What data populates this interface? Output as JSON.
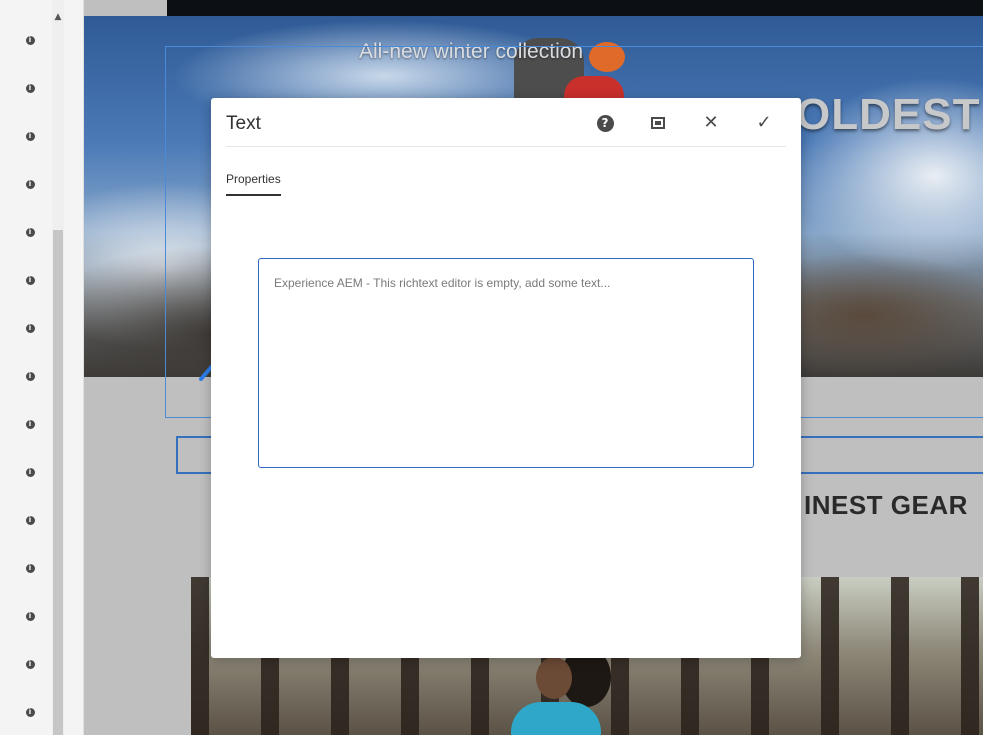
{
  "rail": {
    "item_count": 15,
    "icon": "info-icon",
    "icon_glyph": "i",
    "scroll_up_glyph": "▲"
  },
  "page": {
    "hero_caption": "All-new winter collection",
    "hero_headline": "OLDEST W",
    "section_heading": "INEST GEAR"
  },
  "dialog": {
    "title": "Text",
    "help_glyph": "?",
    "close_glyph": "✕",
    "confirm_glyph": "✓",
    "tabs": [
      {
        "label": "Properties",
        "active": true
      }
    ],
    "editor": {
      "placeholder": "Experience AEM - This richtext editor is empty, add some text..."
    }
  },
  "colors": {
    "accent": "#2d6ac1",
    "arrow": "#2b7de9",
    "component_outline": "#3570bd",
    "icon": "#4b4b4b"
  }
}
